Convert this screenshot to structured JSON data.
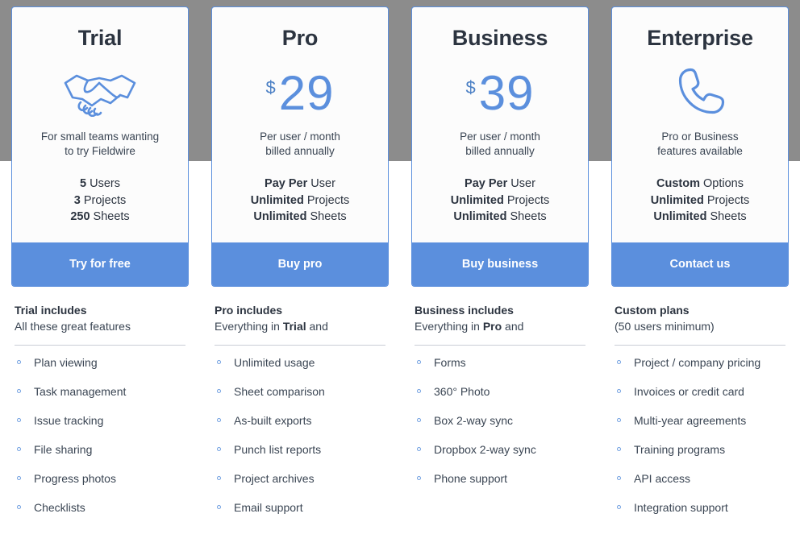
{
  "theme": {
    "accent": "#5b8fdd",
    "accent_dark": "#4a7fc4",
    "band": "#8c8c8c",
    "card_bg": "#fcfcfc",
    "text": "#3a4553",
    "heading": "#2c3440"
  },
  "plans": [
    {
      "name": "Trial",
      "hero_type": "icon",
      "icon": "handshake-icon",
      "price_currency": "",
      "price_amount": "",
      "blurb_line1": "For small teams wanting",
      "blurb_line2": "to try Fieldwire",
      "specs": [
        {
          "strong": "5",
          "rest": " Users"
        },
        {
          "strong": "3",
          "rest": " Projects"
        },
        {
          "strong": "250",
          "rest": " Sheets"
        }
      ],
      "cta_label": "Try for free",
      "features_title": "Trial includes",
      "features_sub_pre": "All these great features",
      "features_sub_strong": "",
      "features_sub_post": "",
      "features": [
        "Plan viewing",
        "Task management",
        "Issue tracking",
        "File sharing",
        "Progress photos",
        "Checklists"
      ]
    },
    {
      "name": "Pro",
      "hero_type": "price",
      "icon": "",
      "price_currency": "$",
      "price_amount": "29",
      "blurb_line1": "Per user / month",
      "blurb_line2": "billed annually",
      "specs": [
        {
          "strong": "Pay Per",
          "rest": " User"
        },
        {
          "strong": "Unlimited",
          "rest": " Projects"
        },
        {
          "strong": "Unlimited",
          "rest": " Sheets"
        }
      ],
      "cta_label": "Buy pro",
      "features_title": "Pro includes",
      "features_sub_pre": "Everything in ",
      "features_sub_strong": "Trial",
      "features_sub_post": " and",
      "features": [
        "Unlimited usage",
        "Sheet comparison",
        "As-built exports",
        "Punch list reports",
        "Project archives",
        "Email support"
      ]
    },
    {
      "name": "Business",
      "hero_type": "price",
      "icon": "",
      "price_currency": "$",
      "price_amount": "39",
      "blurb_line1": "Per user / month",
      "blurb_line2": "billed annually",
      "specs": [
        {
          "strong": "Pay Per",
          "rest": " User"
        },
        {
          "strong": "Unlimited",
          "rest": " Projects"
        },
        {
          "strong": "Unlimited",
          "rest": " Sheets"
        }
      ],
      "cta_label": "Buy business",
      "features_title": "Business includes",
      "features_sub_pre": "Everything in ",
      "features_sub_strong": "Pro",
      "features_sub_post": " and",
      "features": [
        "Forms",
        "360° Photo",
        "Box 2-way sync",
        "Dropbox 2-way sync",
        "Phone support"
      ]
    },
    {
      "name": "Enterprise",
      "hero_type": "icon",
      "icon": "phone-icon",
      "price_currency": "",
      "price_amount": "",
      "blurb_line1": "Pro or Business",
      "blurb_line2": "features available",
      "specs": [
        {
          "strong": "Custom",
          "rest": " Options"
        },
        {
          "strong": "Unlimited",
          "rest": " Projects"
        },
        {
          "strong": "Unlimited",
          "rest": " Sheets"
        }
      ],
      "cta_label": "Contact us",
      "features_title": "Custom plans",
      "features_sub_pre": "(50 users minimum)",
      "features_sub_strong": "",
      "features_sub_post": "",
      "features": [
        "Project / company pricing",
        "Invoices or credit card",
        "Multi-year agreements",
        "Training programs",
        "API access",
        "Integration support"
      ]
    }
  ]
}
